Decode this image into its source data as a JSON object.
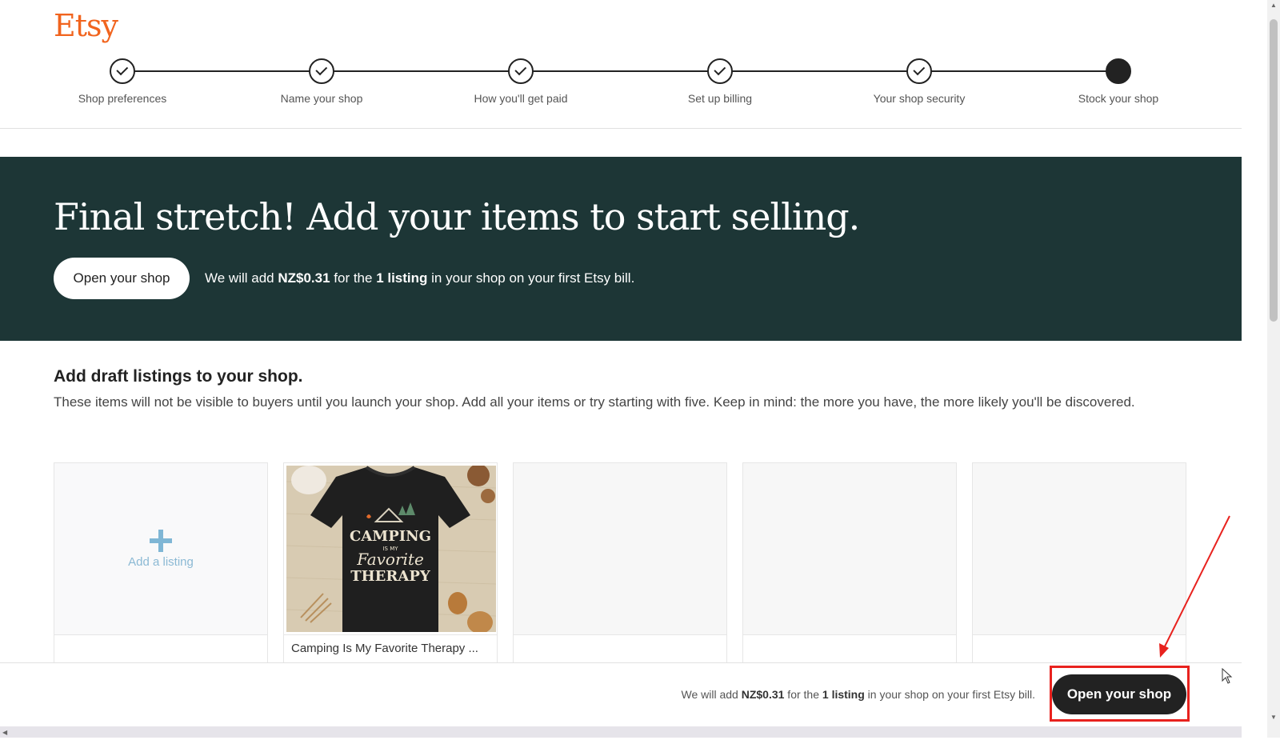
{
  "brand": {
    "logo": "Etsy",
    "color": "#f1641e"
  },
  "steps": [
    {
      "label": "Shop preferences",
      "state": "done"
    },
    {
      "label": "Name your shop",
      "state": "done"
    },
    {
      "label": "How you'll get paid",
      "state": "done"
    },
    {
      "label": "Set up billing",
      "state": "done"
    },
    {
      "label": "Your shop security",
      "state": "done"
    },
    {
      "label": "Stock your shop",
      "state": "current"
    }
  ],
  "hero": {
    "title": "Final stretch! Add your items to start selling.",
    "button_label": "Open your shop",
    "note_prefix": "We will add ",
    "note_amount": "NZ$0.31",
    "note_middle": " for the ",
    "note_count": "1 listing",
    "note_suffix": " in your shop on your first Etsy bill.",
    "background": "#1d3636"
  },
  "drafts": {
    "title": "Add draft listings to your shop.",
    "description": "These items will not be visible to buyers until you launch your shop. Add all your items or try starting with five. Keep in mind: the more you have, the more likely you'll be discovered.",
    "add_label": "Add a listing",
    "listing": {
      "title": "Camping Is My Favorite Therapy ...",
      "image_text_1": "CAMPING",
      "image_text_2": "IS MY",
      "image_text_3": "Favorite",
      "image_text_4": "THERAPY"
    }
  },
  "footer": {
    "note_prefix": "We will add ",
    "note_amount": "NZ$0.31",
    "note_middle": " for the ",
    "note_count": "1 listing",
    "note_suffix": " in your shop on your first Etsy bill.",
    "button_label": "Open your shop"
  },
  "annotation": {
    "color": "#e8221e"
  }
}
